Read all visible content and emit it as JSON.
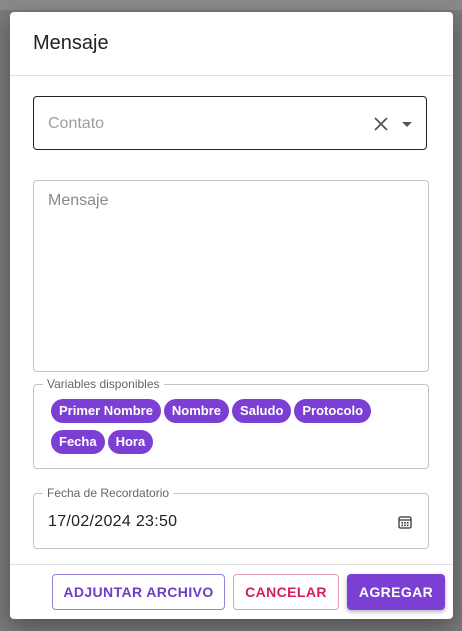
{
  "dialog": {
    "title": "Mensaje"
  },
  "contact": {
    "placeholder": "Contato"
  },
  "message": {
    "placeholder": "Mensaje"
  },
  "variables": {
    "legend": "Variables disponibles",
    "chips": [
      "Primer Nombre",
      "Nombre",
      "Saludo",
      "Protocolo",
      "Fecha",
      "Hora"
    ]
  },
  "reminder": {
    "legend": "Fecha de Recordatorio",
    "value": "17/02/2024 23:50"
  },
  "buttons": {
    "attach": "ADJUNTAR ARCHIVO",
    "cancel": "CANCELAR",
    "add": "AGREGAR"
  },
  "icons": {
    "clear": "close-icon",
    "dropdown": "arrow-drop-down-icon",
    "calendar": "calendar-icon"
  },
  "colors": {
    "accent": "#7b3fd3",
    "cancel": "#d81b60"
  }
}
